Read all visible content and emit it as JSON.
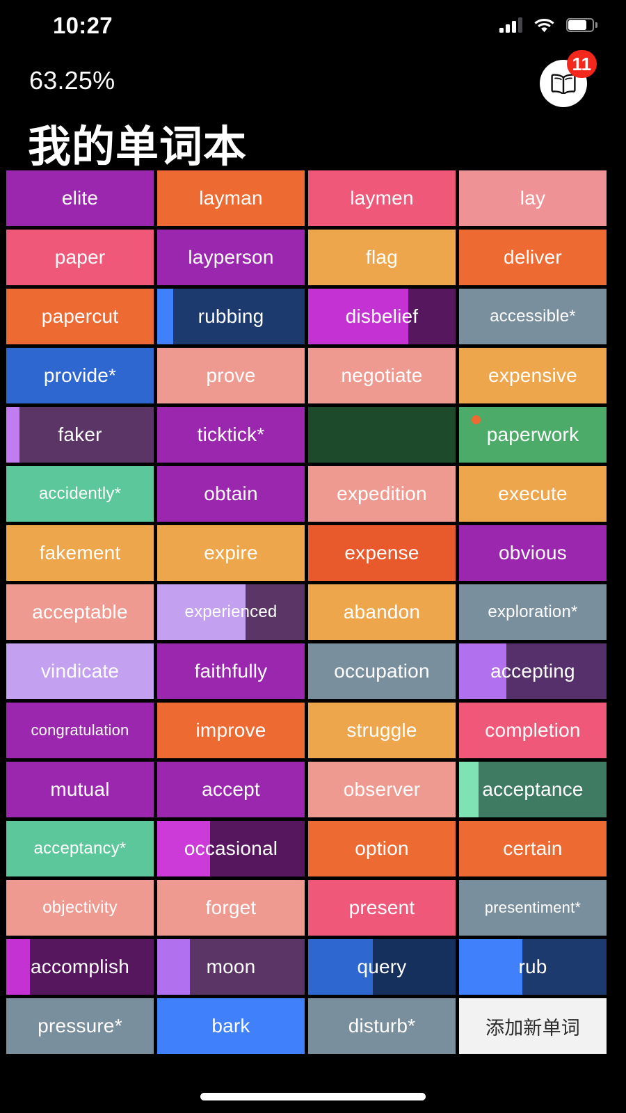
{
  "status_bar": {
    "time": "10:27",
    "signal_icon": "cellular-signal-icon",
    "wifi_icon": "wifi-icon",
    "battery_icon": "battery-icon",
    "signal_bars_filled": 3,
    "signal_bars_total": 4,
    "battery_level_pct": 70
  },
  "header": {
    "progress_label": "63.25%",
    "title": "我的单词本",
    "book_button": {
      "icon": "open-book-icon",
      "badge_count": "11",
      "badge_color": "#f4271c",
      "circle_color": "#ffffff"
    }
  },
  "add_button": {
    "label": "添加新单词",
    "background": "#f2f2f2",
    "text_color": "#2a2a2a"
  },
  "palette": {
    "purple": "#9a27ad",
    "purple_dark": "#56175e",
    "purple_light": "#c07cf0",
    "purple_muted_dark": "#5a3566",
    "magenta": "#c432d4",
    "magenta_bright": "#cc3ad8",
    "orange": "#ed6b33",
    "orange_light": "#eda64c",
    "orange_deep": "#e85a2c",
    "pink": "#ef5878",
    "pink_light": "#ef9295",
    "salmon": "#ef9a90",
    "blue": "#2f67d0",
    "blue_bright": "#4080fb",
    "navy": "#1d3a6e",
    "slate": "#7a8f9e",
    "green": "#4cab68",
    "green_dark": "#1e4a2c",
    "mint": "#5cc79a",
    "teal_dark": "#3f7a63",
    "white": "#ffffff"
  },
  "grid": {
    "columns": 4,
    "rows": 15,
    "tiles": [
      {
        "word": "elite",
        "base": "#9a27ad",
        "fill": "#9a27ad",
        "fill_pct": 100
      },
      {
        "word": "layman",
        "base": "#ed6b33",
        "fill": "#ed6b33",
        "fill_pct": 100
      },
      {
        "word": "laymen",
        "base": "#ef5878",
        "fill": "#ef5878",
        "fill_pct": 100
      },
      {
        "word": "lay",
        "base": "#ef9295",
        "fill": "#ef9295",
        "fill_pct": 100
      },
      {
        "word": "paper",
        "base": "#ef5878",
        "fill": "#ef5878",
        "fill_pct": 100
      },
      {
        "word": "layperson",
        "base": "#9a27ad",
        "fill": "#9a27ad",
        "fill_pct": 100
      },
      {
        "word": "flag",
        "base": "#eda64c",
        "fill": "#eda64c",
        "fill_pct": 100
      },
      {
        "word": "deliver",
        "base": "#ed6b33",
        "fill": "#ed6b33",
        "fill_pct": 100
      },
      {
        "word": "papercut",
        "base": "#ed6b33",
        "fill": "#ed6b33",
        "fill_pct": 100
      },
      {
        "word": "rubbing",
        "base": "#1d3a6e",
        "fill": "#4080fb",
        "fill_pct": 11
      },
      {
        "word": "disbelief",
        "base": "#56175e",
        "fill": "#c432d4",
        "fill_pct": 68
      },
      {
        "word": "accessible*",
        "base": "#7a8f9e",
        "fill": "#7a8f9e",
        "fill_pct": 100
      },
      {
        "word": "provide*",
        "base": "#2f67d0",
        "fill": "#2f67d0",
        "fill_pct": 100
      },
      {
        "word": "prove",
        "base": "#ef9a90",
        "fill": "#ef9a90",
        "fill_pct": 100
      },
      {
        "word": "negotiate",
        "base": "#ef9a90",
        "fill": "#ef9a90",
        "fill_pct": 100
      },
      {
        "word": "expensive",
        "base": "#eda64c",
        "fill": "#eda64c",
        "fill_pct": 100
      },
      {
        "word": "faker",
        "base": "#5a3566",
        "fill": "#c07cf0",
        "fill_pct": 9
      },
      {
        "word": "ticktick*",
        "base": "#9a27ad",
        "fill": "#9a27ad",
        "fill_pct": 100
      },
      {
        "word": "",
        "base": "#1e4a2c",
        "fill": "#1e4a2c",
        "fill_pct": 0
      },
      {
        "word": "paperwork",
        "base": "#4cab68",
        "fill": "#4cab68",
        "fill_pct": 100,
        "dot": "#ed6b33"
      },
      {
        "word": "accidently*",
        "base": "#5cc79a",
        "fill": "#5cc79a",
        "fill_pct": 100
      },
      {
        "word": "obtain",
        "base": "#9a27ad",
        "fill": "#9a27ad",
        "fill_pct": 100
      },
      {
        "word": "expedition",
        "base": "#ef9a90",
        "fill": "#ef9a90",
        "fill_pct": 100
      },
      {
        "word": "execute",
        "base": "#eda64c",
        "fill": "#eda64c",
        "fill_pct": 100
      },
      {
        "word": "fakement",
        "base": "#eda64c",
        "fill": "#eda64c",
        "fill_pct": 100
      },
      {
        "word": "expire",
        "base": "#eda64c",
        "fill": "#eda64c",
        "fill_pct": 100
      },
      {
        "word": "expense",
        "base": "#e85a2c",
        "fill": "#e85a2c",
        "fill_pct": 100
      },
      {
        "word": "obvious",
        "base": "#9a27ad",
        "fill": "#9a27ad",
        "fill_pct": 100
      },
      {
        "word": "acceptable",
        "base": "#ef9a90",
        "fill": "#ef9a90",
        "fill_pct": 100
      },
      {
        "word": "experienced",
        "base": "#5a3566",
        "fill": "#c3a0f0",
        "fill_pct": 60
      },
      {
        "word": "abandon",
        "base": "#eda64c",
        "fill": "#eda64c",
        "fill_pct": 100
      },
      {
        "word": "exploration*",
        "base": "#7a8f9e",
        "fill": "#7a8f9e",
        "fill_pct": 100
      },
      {
        "word": "vindicate",
        "base": "#c3a0f0",
        "fill": "#c3a0f0",
        "fill_pct": 100
      },
      {
        "word": "faithfully",
        "base": "#9a27ad",
        "fill": "#9a27ad",
        "fill_pct": 100
      },
      {
        "word": "occupation",
        "base": "#7a8f9e",
        "fill": "#7a8f9e",
        "fill_pct": 100
      },
      {
        "word": "accepting",
        "base": "#56306b",
        "fill": "#b171ee",
        "fill_pct": 32
      },
      {
        "word": "congratulation",
        "base": "#9a27ad",
        "fill": "#9a27ad",
        "fill_pct": 100
      },
      {
        "word": "improve",
        "base": "#ed6b33",
        "fill": "#ed6b33",
        "fill_pct": 100
      },
      {
        "word": "struggle",
        "base": "#eda64c",
        "fill": "#eda64c",
        "fill_pct": 100
      },
      {
        "word": "completion",
        "base": "#ef5878",
        "fill": "#ef5878",
        "fill_pct": 100
      },
      {
        "word": "mutual",
        "base": "#9a27ad",
        "fill": "#9a27ad",
        "fill_pct": 100
      },
      {
        "word": "accept",
        "base": "#9a27ad",
        "fill": "#9a27ad",
        "fill_pct": 100
      },
      {
        "word": "observer",
        "base": "#ef9a90",
        "fill": "#ef9a90",
        "fill_pct": 100
      },
      {
        "word": "acceptance",
        "base": "#3f7a63",
        "fill": "#7ee2b4",
        "fill_pct": 13
      },
      {
        "word": "acceptancy*",
        "base": "#5cc79a",
        "fill": "#5cc79a",
        "fill_pct": 100
      },
      {
        "word": "occasional",
        "base": "#56175e",
        "fill": "#cc3ad8",
        "fill_pct": 36
      },
      {
        "word": "option",
        "base": "#ed6b33",
        "fill": "#ed6b33",
        "fill_pct": 100
      },
      {
        "word": "certain",
        "base": "#ed6b33",
        "fill": "#ed6b33",
        "fill_pct": 100
      },
      {
        "word": "objectivity",
        "base": "#ef9a90",
        "fill": "#ef9a90",
        "fill_pct": 100
      },
      {
        "word": "forget",
        "base": "#ef9a90",
        "fill": "#ef9a90",
        "fill_pct": 100
      },
      {
        "word": "present",
        "base": "#ef5878",
        "fill": "#ef5878",
        "fill_pct": 100
      },
      {
        "word": "presentiment*",
        "base": "#7a8f9e",
        "fill": "#7a8f9e",
        "fill_pct": 100
      },
      {
        "word": "accomplish",
        "base": "#56175e",
        "fill": "#c432d4",
        "fill_pct": 16
      },
      {
        "word": "moon",
        "base": "#5a3566",
        "fill": "#b171ee",
        "fill_pct": 22
      },
      {
        "word": "query",
        "base": "#16305e",
        "fill": "#2f67d0",
        "fill_pct": 44
      },
      {
        "word": "rub",
        "base": "#1d3a6e",
        "fill": "#4080fb",
        "fill_pct": 43
      },
      {
        "word": "pressure*",
        "base": "#7a8f9e",
        "fill": "#7a8f9e",
        "fill_pct": 100
      },
      {
        "word": "bark",
        "base": "#4080fb",
        "fill": "#4080fb",
        "fill_pct": 100
      },
      {
        "word": "disturb*",
        "base": "#7a8f9e",
        "fill": "#7a8f9e",
        "fill_pct": 100
      },
      {
        "word": "添加新单词",
        "base": "#f2f2f2",
        "fill": "#f2f2f2",
        "fill_pct": 100,
        "is_add": true
      }
    ]
  }
}
